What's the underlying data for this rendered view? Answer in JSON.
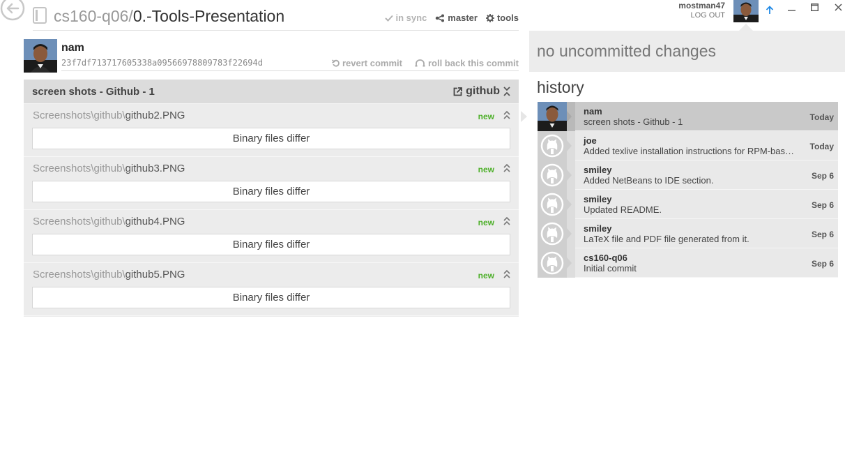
{
  "repo": {
    "owner": "cs160-q06",
    "separator": "/",
    "name": "0.-Tools-Presentation",
    "sync_label": "in sync",
    "branch_label": "master",
    "tools_label": "tools"
  },
  "user": {
    "login": "mostman47",
    "logout_label": "LOG OUT"
  },
  "commit": {
    "author": "nam",
    "sha": "23f7df713717605338a09566978809783f22694d",
    "revert_label": "revert commit",
    "rollback_label": "roll back this commit",
    "message": "screen shots - Github - 1",
    "github_label": "github"
  },
  "files": [
    {
      "dir": "Screenshots\\github\\",
      "name": "github2.PNG",
      "status": "new",
      "body": "Binary files differ"
    },
    {
      "dir": "Screenshots\\github\\",
      "name": "github3.PNG",
      "status": "new",
      "body": "Binary files differ"
    },
    {
      "dir": "Screenshots\\github\\",
      "name": "github4.PNG",
      "status": "new",
      "body": "Binary files differ"
    },
    {
      "dir": "Screenshots\\github\\",
      "name": "github5.PNG",
      "status": "new",
      "body": "Binary files differ"
    }
  ],
  "uncommitted": {
    "label": "no uncommitted changes"
  },
  "history": {
    "title": "history",
    "items": [
      {
        "author": "nam",
        "message": "screen shots - Github - 1",
        "date": "Today",
        "selected": true,
        "avatar": "photo"
      },
      {
        "author": "joe",
        "message": "Added texlive installation instructions for RPM-bas…",
        "date": "Today",
        "selected": false,
        "avatar": "octocat"
      },
      {
        "author": "smiley",
        "message": "Added NetBeans to IDE section.",
        "date": "Sep 6",
        "selected": false,
        "avatar": "octocat"
      },
      {
        "author": "smiley",
        "message": "Updated README.",
        "date": "Sep 6",
        "selected": false,
        "avatar": "octocat"
      },
      {
        "author": "smiley",
        "message": "LaTeX file and PDF file generated from it.",
        "date": "Sep 6",
        "selected": false,
        "avatar": "octocat"
      },
      {
        "author": "cs160-q06",
        "message": "Initial commit",
        "date": "Sep 6",
        "selected": false,
        "avatar": "octocat"
      }
    ]
  },
  "colors": {
    "status_new": "#4caf28",
    "panel_bg": "#ececec",
    "selected_bg": "#c9c9c9",
    "accent_blue": "#1e88e5"
  },
  "icons": {
    "back": "back-arrow-icon",
    "repo": "repository-icon",
    "sync": "check-icon",
    "branch": "branch-icon",
    "tools": "gear-icon",
    "revert": "revert-icon",
    "rollback": "rollback-icon",
    "external": "external-link-icon",
    "collapse": "collapse-icon",
    "sync_up": "arrow-up-icon",
    "minimize": "minimize-icon",
    "maximize": "maximize-icon",
    "close": "close-icon"
  }
}
